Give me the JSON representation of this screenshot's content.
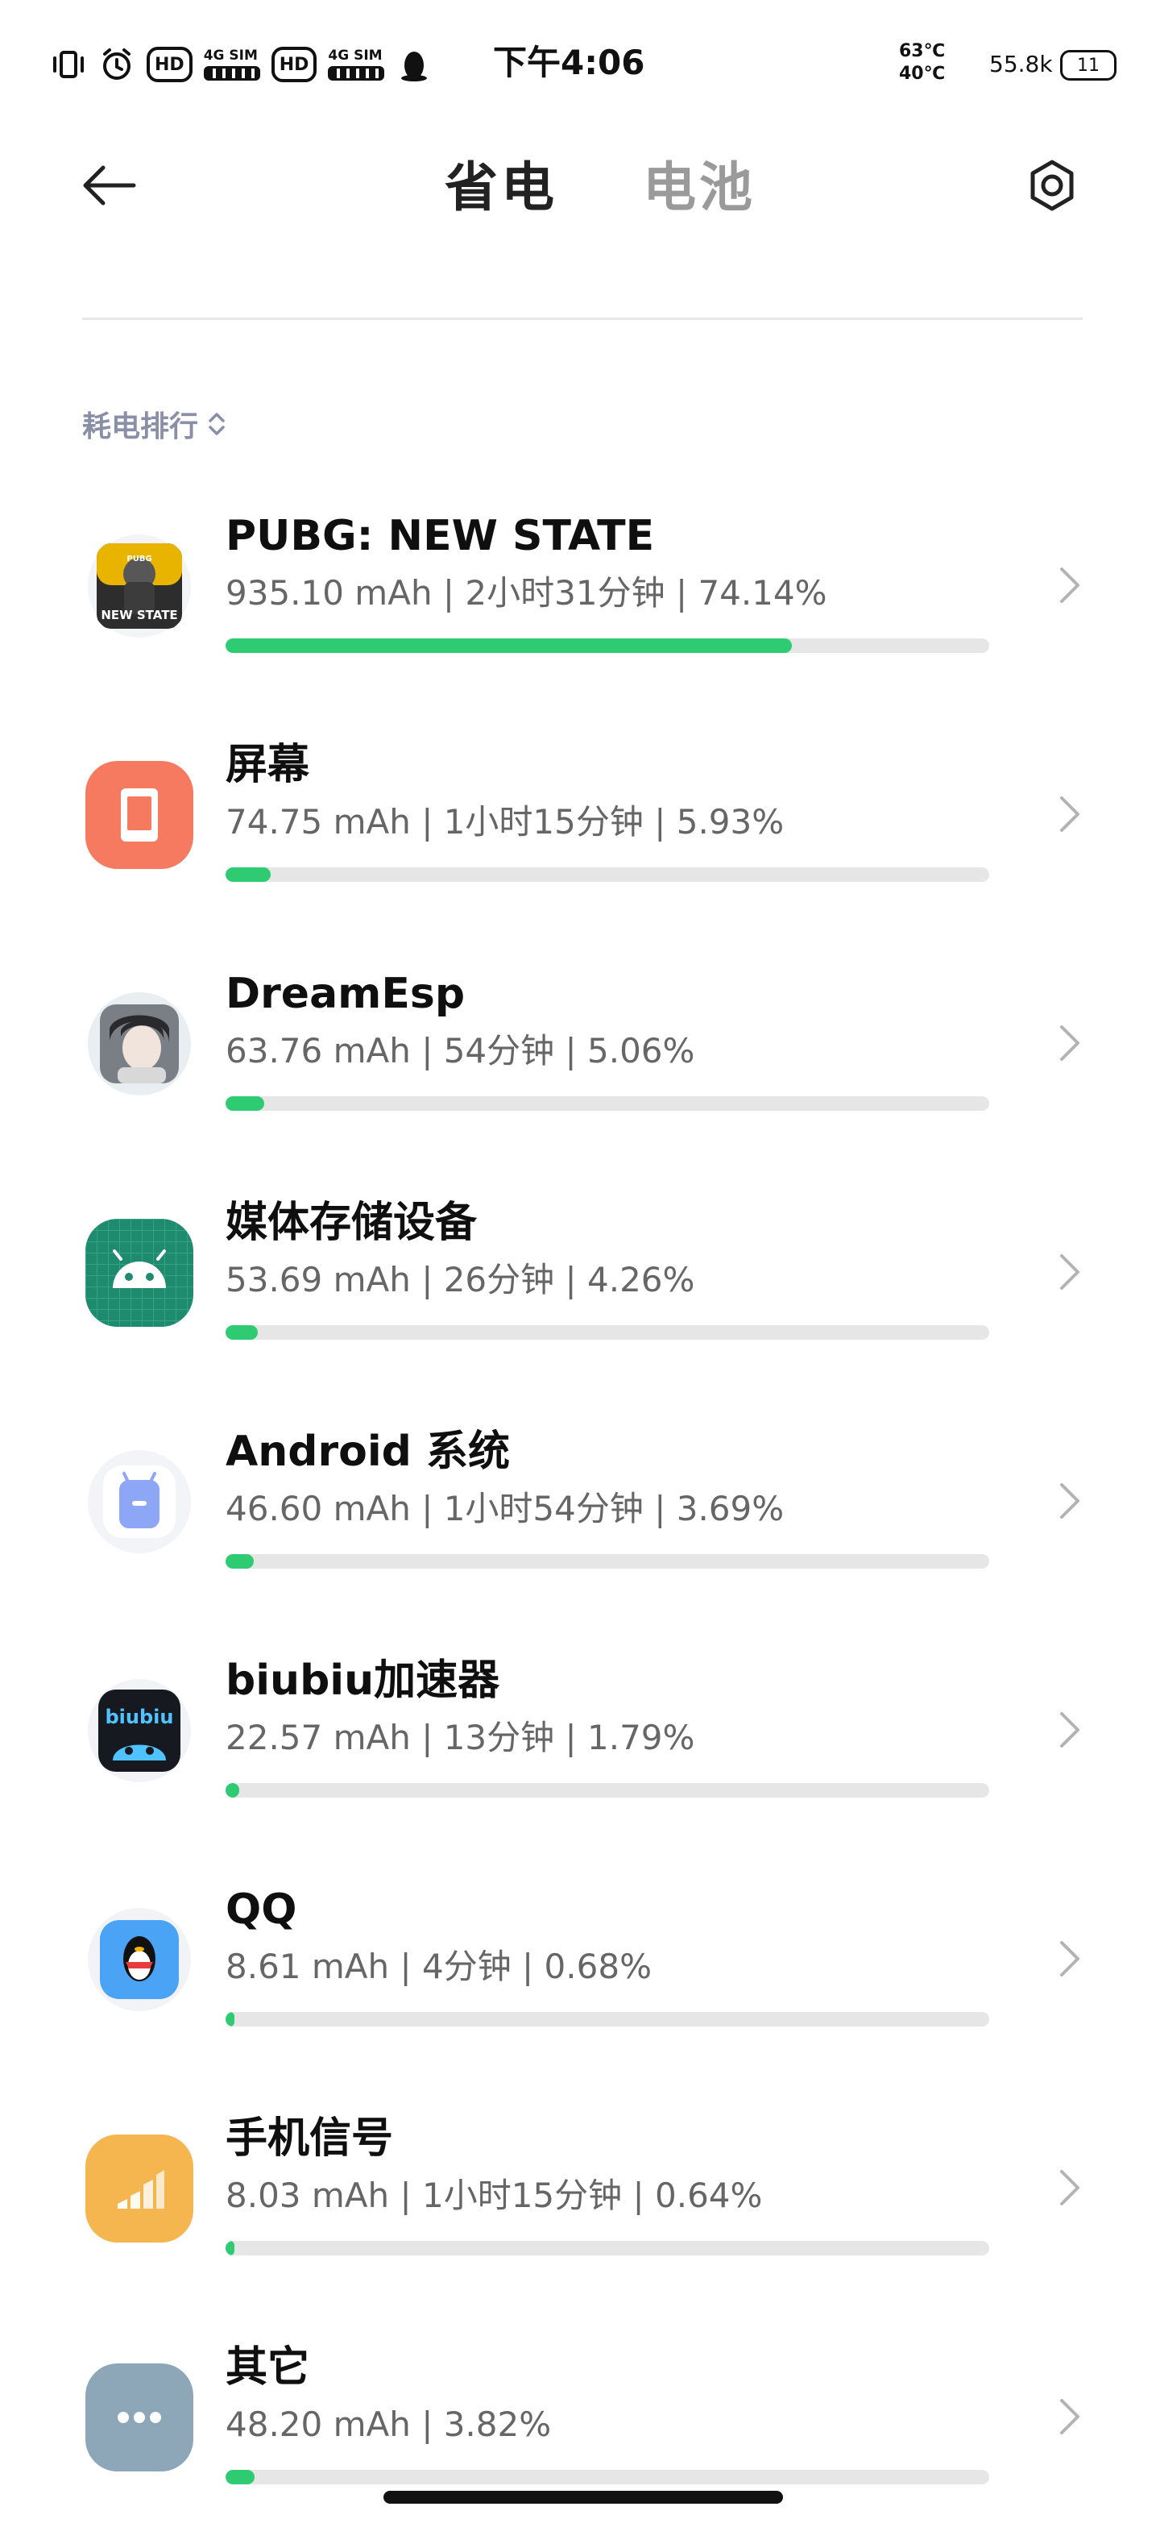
{
  "status_bar": {
    "time": "下午4:06",
    "hd_label": "HD",
    "sim1": "4G SIM",
    "sim2": "4G SIM",
    "temp_top": "63℃",
    "temp_bottom": "40℃",
    "net_speed": "55.8k",
    "battery": "11"
  },
  "header": {
    "tab_active": "省电",
    "tab_inactive": "电池"
  },
  "sort_label": "耗电排行",
  "rows": [
    {
      "name": "PUBG: NEW STATE",
      "meta": "935.10 mAh | 2小时31分钟 | 74.14%",
      "percent": 74.14
    },
    {
      "name": "屏幕",
      "meta": "74.75 mAh | 1小时15分钟 | 5.93%",
      "percent": 5.93
    },
    {
      "name": "DreamEsp",
      "meta": "63.76 mAh | 54分钟 | 5.06%",
      "percent": 5.06
    },
    {
      "name": "媒体存储设备",
      "meta": "53.69 mAh | 26分钟 | 4.26%",
      "percent": 4.26
    },
    {
      "name": "Android 系统",
      "meta": "46.60 mAh | 1小时54分钟 | 3.69%",
      "percent": 3.69
    },
    {
      "name": "biubiu加速器",
      "meta": "22.57 mAh | 13分钟 | 1.79%",
      "percent": 1.79
    },
    {
      "name": "QQ",
      "meta": "8.61 mAh | 4分钟 | 0.68%",
      "percent": 0.68
    },
    {
      "name": "手机信号",
      "meta": "8.03 mAh | 1小时15分钟 | 0.64%",
      "percent": 0.64
    },
    {
      "name": "其它",
      "meta": "48.20 mAh | 3.82%",
      "percent": 3.82
    }
  ],
  "icons": {
    "pubg_text_top": "PUBG",
    "pubg_text_bottom": "NEW STATE",
    "biubiu_text": "biubiu"
  },
  "colors": {
    "accent_green": "#2ecb72",
    "track_gray": "#e6e6e6",
    "screen_icon": "#f57a5f",
    "media_icon": "#1e8a6e",
    "android_icon": "#8ea6f6",
    "signal_icon": "#f6b64f",
    "other_icon": "#8ea7b8"
  }
}
